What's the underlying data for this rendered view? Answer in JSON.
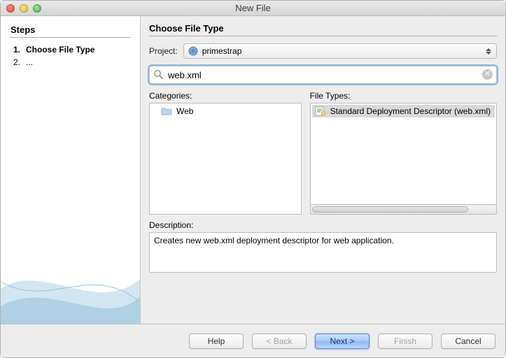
{
  "window": {
    "title": "New File"
  },
  "sidebar": {
    "heading": "Steps",
    "steps": [
      {
        "num": "1.",
        "label": "Choose File Type",
        "current": true
      },
      {
        "num": "2.",
        "label": "...",
        "current": false
      }
    ]
  },
  "main": {
    "heading": "Choose File Type",
    "project_label": "Project:",
    "project_value": "primestrap",
    "search_value": "web.xml",
    "categories_label": "Categories:",
    "filetypes_label": "File Types:",
    "categories": [
      {
        "label": "Web"
      }
    ],
    "filetypes": [
      {
        "label": "Standard Deployment Descriptor (web.xml)",
        "selected": true
      }
    ],
    "description_label": "Description:",
    "description_text": "Creates new web.xml deployment descriptor for web application."
  },
  "buttons": {
    "help": "Help",
    "back": "< Back",
    "next": "Next >",
    "finish": "Finish",
    "cancel": "Cancel"
  }
}
